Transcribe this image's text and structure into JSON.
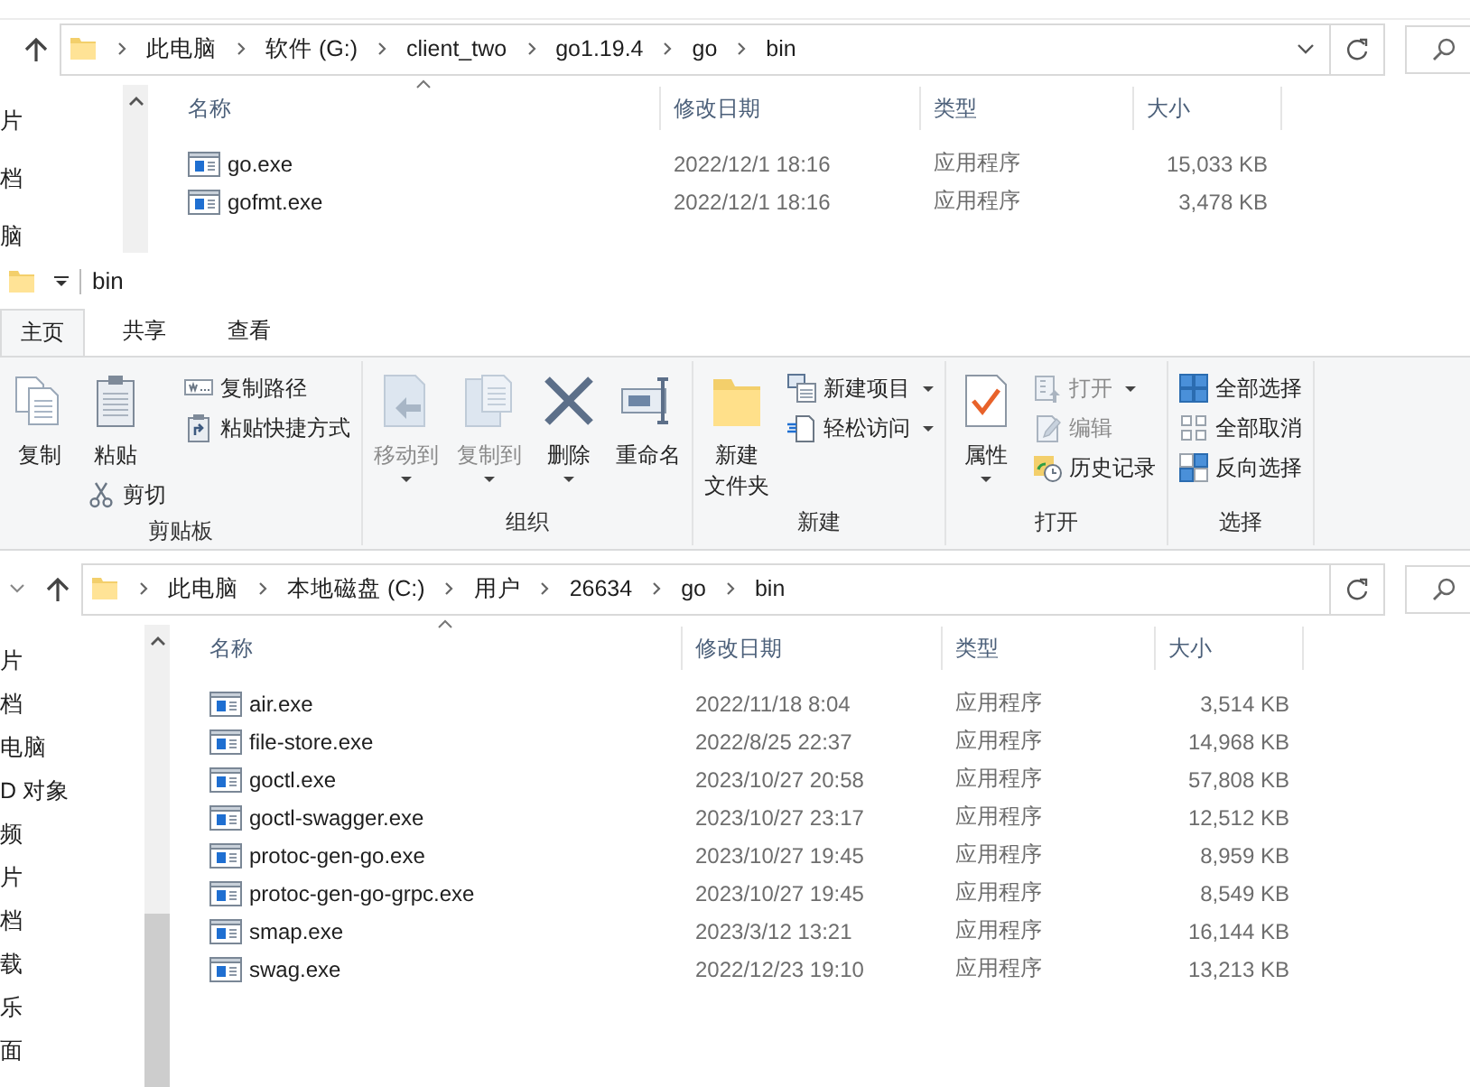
{
  "back_window": {
    "address": {
      "history_dropdown": true,
      "segments": [
        "此电脑",
        "软件 (G:)",
        "client_two",
        "go1.19.4",
        "go",
        "bin"
      ]
    },
    "nav_items": [
      "片",
      "档",
      "脑"
    ],
    "columns": [
      "名称",
      "修改日期",
      "类型",
      "大小"
    ],
    "files": [
      {
        "name": "go.exe",
        "modified": "2022/12/1 18:16",
        "type": "应用程序",
        "size": "15,033 KB"
      },
      {
        "name": "gofmt.exe",
        "modified": "2022/12/1 18:16",
        "type": "应用程序",
        "size": "3,478 KB"
      }
    ]
  },
  "front_window": {
    "title": "bin",
    "tabs": [
      {
        "label": "主页",
        "selected": true
      },
      {
        "label": "共享",
        "selected": false
      },
      {
        "label": "查看",
        "selected": false
      }
    ],
    "ribbon": {
      "groups": [
        {
          "label": "剪贴板",
          "columns": [
            [
              {
                "kind": "large",
                "label": "复制",
                "disabled": false,
                "dropdown": false
              }
            ],
            [
              {
                "kind": "large",
                "label": "粘贴",
                "disabled": false,
                "dropdown": false
              },
              {
                "kind": "small",
                "label": "剪切",
                "disabled": false,
                "dropdown": false
              }
            ],
            [
              {
                "kind": "small",
                "label": "复制路径",
                "disabled": false,
                "dropdown": false
              },
              {
                "kind": "small",
                "label": "粘贴快捷方式",
                "disabled": false,
                "dropdown": false
              }
            ]
          ]
        },
        {
          "label": "组织",
          "columns": [
            [
              {
                "kind": "large",
                "label": "移动到",
                "disabled": true,
                "dropdown": true
              }
            ],
            [
              {
                "kind": "large",
                "label": "复制到",
                "disabled": true,
                "dropdown": true
              }
            ],
            [
              {
                "kind": "large",
                "label": "删除",
                "disabled": false,
                "dropdown": true
              }
            ],
            [
              {
                "kind": "large",
                "label": "重命名",
                "disabled": false,
                "dropdown": false
              }
            ]
          ]
        },
        {
          "label": "新建",
          "columns": [
            [
              {
                "kind": "large",
                "label": [
                  "新建",
                  "文件夹"
                ],
                "disabled": false,
                "dropdown": false
              }
            ],
            [
              {
                "kind": "small",
                "label": "新建项目",
                "disabled": false,
                "dropdown": true
              },
              {
                "kind": "small",
                "label": "轻松访问",
                "disabled": false,
                "dropdown": true
              }
            ]
          ]
        },
        {
          "label": "打开",
          "columns": [
            [
              {
                "kind": "large",
                "label": "属性",
                "disabled": false,
                "dropdown": true
              }
            ],
            [
              {
                "kind": "small",
                "label": "打开",
                "disabled": true,
                "dropdown": true
              },
              {
                "kind": "small",
                "label": "编辑",
                "disabled": true,
                "dropdown": false
              },
              {
                "kind": "small",
                "label": "历史记录",
                "disabled": false,
                "dropdown": false
              }
            ]
          ]
        },
        {
          "label": "选择",
          "columns": [
            [
              {
                "kind": "small",
                "label": "全部选择",
                "disabled": false,
                "dropdown": false
              },
              {
                "kind": "small",
                "label": "全部取消",
                "disabled": false,
                "dropdown": false
              },
              {
                "kind": "small",
                "label": "反向选择",
                "disabled": false,
                "dropdown": false
              }
            ]
          ]
        }
      ]
    },
    "address": {
      "recent_locations_button": true,
      "segments": [
        "此电脑",
        "本地磁盘 (C:)",
        "用户",
        "26634",
        "go",
        "bin"
      ]
    },
    "nav_items": [
      "片",
      "档",
      "电脑",
      "D 对象",
      "频",
      "片",
      "档",
      "载",
      "乐",
      "面"
    ],
    "columns": [
      "名称",
      "修改日期",
      "类型",
      "大小"
    ],
    "files": [
      {
        "name": "air.exe",
        "modified": "2022/11/18 8:04",
        "type": "应用程序",
        "size": "3,514 KB"
      },
      {
        "name": "file-store.exe",
        "modified": "2022/8/25 22:37",
        "type": "应用程序",
        "size": "14,968 KB"
      },
      {
        "name": "goctl.exe",
        "modified": "2023/10/27 20:58",
        "type": "应用程序",
        "size": "57,808 KB"
      },
      {
        "name": "goctl-swagger.exe",
        "modified": "2023/10/27 23:17",
        "type": "应用程序",
        "size": "12,512 KB"
      },
      {
        "name": "protoc-gen-go.exe",
        "modified": "2023/10/27 19:45",
        "type": "应用程序",
        "size": "8,959 KB"
      },
      {
        "name": "protoc-gen-go-grpc.exe",
        "modified": "2023/10/27 19:45",
        "type": "应用程序",
        "size": "8,549 KB"
      },
      {
        "name": "smap.exe",
        "modified": "2023/3/12 13:21",
        "type": "应用程序",
        "size": "16,144 KB"
      },
      {
        "name": "swag.exe",
        "modified": "2022/12/23 19:10",
        "type": "应用程序",
        "size": "13,213 KB"
      }
    ]
  }
}
